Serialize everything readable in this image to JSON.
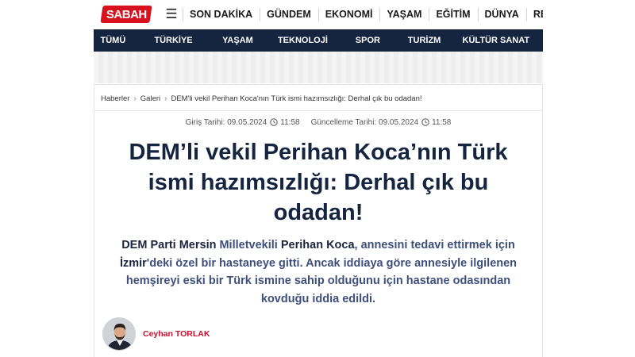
{
  "header": {
    "logo_text": "SABAH",
    "menu_icon": "hamburger-menu-icon",
    "nav": [
      "SON DAKİKA",
      "GÜNDEM",
      "EKONOMİ",
      "YAŞAM",
      "EĞİTİM",
      "DÜNYA",
      "RESMİ"
    ]
  },
  "categories": [
    "TÜMÜ",
    "TÜRKİYE",
    "YAŞAM",
    "TEKNOLOJİ",
    "SPOR",
    "TURİZM",
    "KÜLTÜR SANAT"
  ],
  "breadcrumb": [
    "Haberler",
    "Galeri",
    "DEM'li vekil Perihan Koca'nın Türk ismi hazımsızlığı: Derhal çık bu odadan!"
  ],
  "dates": {
    "published_label": "Giriş Tarihi:",
    "published_date": "09.05.2024",
    "published_time": "11:58",
    "updated_label": "Güncelleme Tarihi:",
    "updated_date": "09.05.2024",
    "updated_time": "11:58"
  },
  "article": {
    "headline": "DEM’li vekil Perihan Koca’nın Türk ismi hazımsızlığı: Derhal çık bu odadan!",
    "summary": {
      "p1": "DEM Parti Mersin",
      "p2": " Milletvekili ",
      "p3": "Perihan Koca",
      "p4": ", annesini tedavi ettirmek için ",
      "p5": "İzmir",
      "p6": "'deki özel bir hastaneye gitti. Ancak iddiaya göre annesiyle ilgilenen hemşireyi eski bir Türk ismine sahip olduğunu için hastane odasından kovduğu iddia edildi."
    }
  },
  "author": {
    "name": "Ceyhan TORLAK"
  },
  "colors": {
    "brand_red": "#d8111e",
    "navy": "#15243f",
    "author_red": "#c8102e"
  }
}
